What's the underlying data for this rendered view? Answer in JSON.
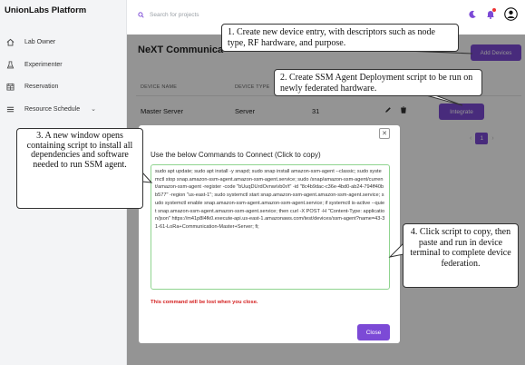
{
  "app": {
    "title": "UnionLabs Platform"
  },
  "sidebar": {
    "items": [
      {
        "label": "Lab Owner",
        "icon": "home-icon"
      },
      {
        "label": "Experimenter",
        "icon": "flask-icon"
      },
      {
        "label": "Reservation",
        "icon": "calendar-icon"
      },
      {
        "label": "Resource Schedule",
        "icon": "list-icon",
        "chevron": "⌄"
      }
    ]
  },
  "topbar": {
    "search_placeholder": "Search for projects",
    "icons": [
      "moon-icon",
      "notification-icon",
      "user-avatar-icon"
    ]
  },
  "main": {
    "title": "NeXT Communica",
    "add_button": "Add Devices",
    "table": {
      "headers": [
        "DEVICE NAME",
        "DEVICE TYPE"
      ],
      "row": {
        "name": "Master Server",
        "type": "Server",
        "id": "31",
        "action_button": "Integrate"
      }
    },
    "pagination": {
      "prev": "‹",
      "current": "1",
      "next": "›"
    }
  },
  "modal": {
    "title": "Use the below Commands to Connect (Click to copy)",
    "command": "sudo apt update; sudo apt install -y snapd; sudo snap install amazon-ssm-agent --classic; sudo systemctl stop snap.amazon-ssm-agent.amazon-ssm-agent.service; sudo /snap/amazon-ssm-agent/current/amazon-ssm-agent -register -code \"bUuqDUrdOvnw/vb0r/t\" -id \"8c4b9dac-c36e-4bd0-ab24-794ff40bb577\" -region \"us-east-1\"; sudo systemctl start snap.amazon-ssm-agent.amazon-ssm-agent.service; sudo systemctl enable snap.amazon-ssm-agent.amazon-ssm-agent.service; if systemctl is-active --quiet snap.amazon-ssm-agent.amazon-ssm-agent.service; then curl -X POST -H \"Content-Type: application/json\" https://m41p8l4fk0.execute-api.us-east-1.amazonaws.com/test/devices/ssm-agent?name=43-31-61-LoRa+Communication-Master+Server; fi;",
    "warning": "This command will be lost when you close.",
    "close_button": "Close",
    "close_icon": "✕"
  },
  "callouts": {
    "c1": "1. Create new device entry, with descriptors such as node type, RF hardware, and purpose.",
    "c2": "2. Create SSM Agent Deployment script to be run on newly federated hardware.",
    "c3": "3. A new window opens containing script to install all dependencies and software needed to run SSM agent.",
    "c4": "4. Click script to copy, then paste and run in device terminal to complete device federation."
  },
  "colors": {
    "accent": "#7c4ad6",
    "warning": "#d42020",
    "command_border": "#8fd48f"
  }
}
